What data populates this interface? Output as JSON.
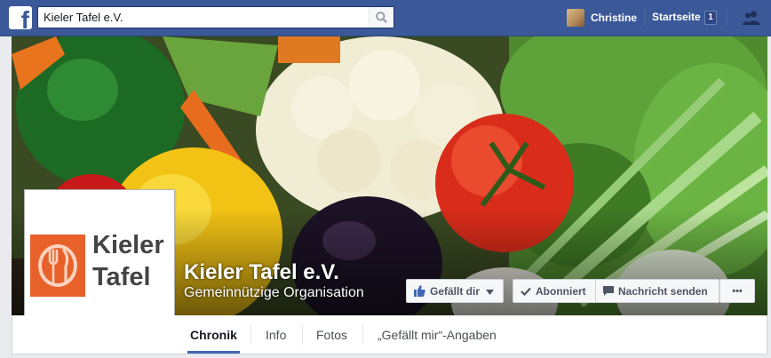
{
  "topbar": {
    "logo_letter": "f",
    "search": {
      "value": "Kieler Tafel e.V.",
      "placeholder": ""
    },
    "user": {
      "name": "Christine"
    },
    "home": {
      "label": "Startseite",
      "badge": "1"
    }
  },
  "page": {
    "name": "Kieler Tafel e.V.",
    "category": "Gemeinnützige Organisation",
    "logo": {
      "line1": "Kieler",
      "line2": "Tafel"
    }
  },
  "actions": {
    "like": "Gefällt dir",
    "subscribed": "Abonniert",
    "message": "Nachricht senden",
    "more": "•••"
  },
  "tabs": [
    {
      "label": "Chronik"
    },
    {
      "label": "Info"
    },
    {
      "label": "Fotos"
    },
    {
      "label": "„Gefällt mir“-Angaben"
    }
  ],
  "colors": {
    "brand": "#3b5998",
    "logo_orange": "#e8602a",
    "active_tab": "#4267b2"
  },
  "icons": [
    "search-icon",
    "thumbs-up-icon",
    "chevron-down-icon",
    "checkmark-icon",
    "message-icon",
    "friends-icon",
    "more-dots-icon"
  ]
}
